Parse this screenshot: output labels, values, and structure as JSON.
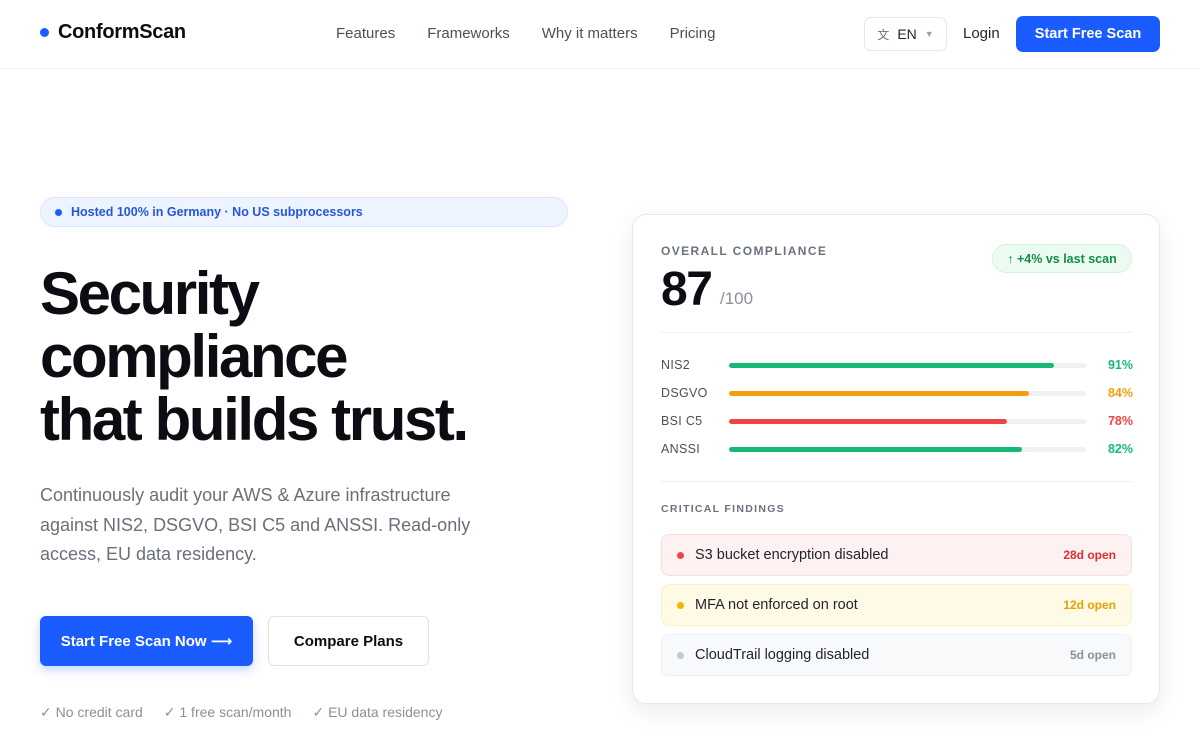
{
  "brand": {
    "name": "ConformScan",
    "accent": "#1a5cff"
  },
  "nav": {
    "links": [
      "Features",
      "Frameworks",
      "Why it matters",
      "Pricing"
    ],
    "language": "EN",
    "login": "Login",
    "cta": "Start Free Scan"
  },
  "hero": {
    "badge": "Hosted 100% in Germany · No US subprocessors",
    "headline": [
      "Security",
      "compliance",
      "that builds trust."
    ],
    "subtitle": "Continuously audit your AWS & Azure infrastructure against NIS2, DSGVO, BSI C5 and ANSSI. Read-only access, EU data residency.",
    "primary_button": "Start Free Scan Now ⟶",
    "secondary_button": "Compare Plans",
    "perks": [
      "✓ No credit card",
      "✓ 1 free scan/month",
      "✓ EU data residency"
    ]
  },
  "card": {
    "label": "OVERALL COMPLIANCE",
    "score": "87",
    "score_max": "/100",
    "delta": "↑ +4% vs last scan",
    "frameworks": [
      {
        "name": "NIS2",
        "percent": 91,
        "percent_label": "91%",
        "color": "#16b877"
      },
      {
        "name": "DSGVO",
        "percent": 84,
        "percent_label": "84%",
        "color": "#f59e0b"
      },
      {
        "name": "BSI C5",
        "percent": 78,
        "percent_label": "78%",
        "color": "#ef4444"
      },
      {
        "name": "ANSSI",
        "percent": 82,
        "percent_label": "82%",
        "color": "#16b877"
      }
    ],
    "findings_label": "CRITICAL FINDINGS",
    "findings": [
      {
        "title": "S3 bucket encryption disabled",
        "age": "28d open",
        "severity": "critical",
        "bg": "#fef1f1",
        "border": "#fbdcdc",
        "dot": "#ef4444",
        "age_color": "#dc2f2f"
      },
      {
        "title": "MFA not enforced on root",
        "age": "12d open",
        "severity": "high",
        "bg": "#fffae6",
        "border": "#fbefc4",
        "dot": "#f5b400",
        "age_color": "#e5a100"
      },
      {
        "title": "CloudTrail logging disabled",
        "age": "5d open",
        "severity": "low",
        "bg": "#f8f9fb",
        "border": "#eceef2",
        "dot": "#c4c8cf",
        "age_color": "#8a909a"
      }
    ]
  }
}
